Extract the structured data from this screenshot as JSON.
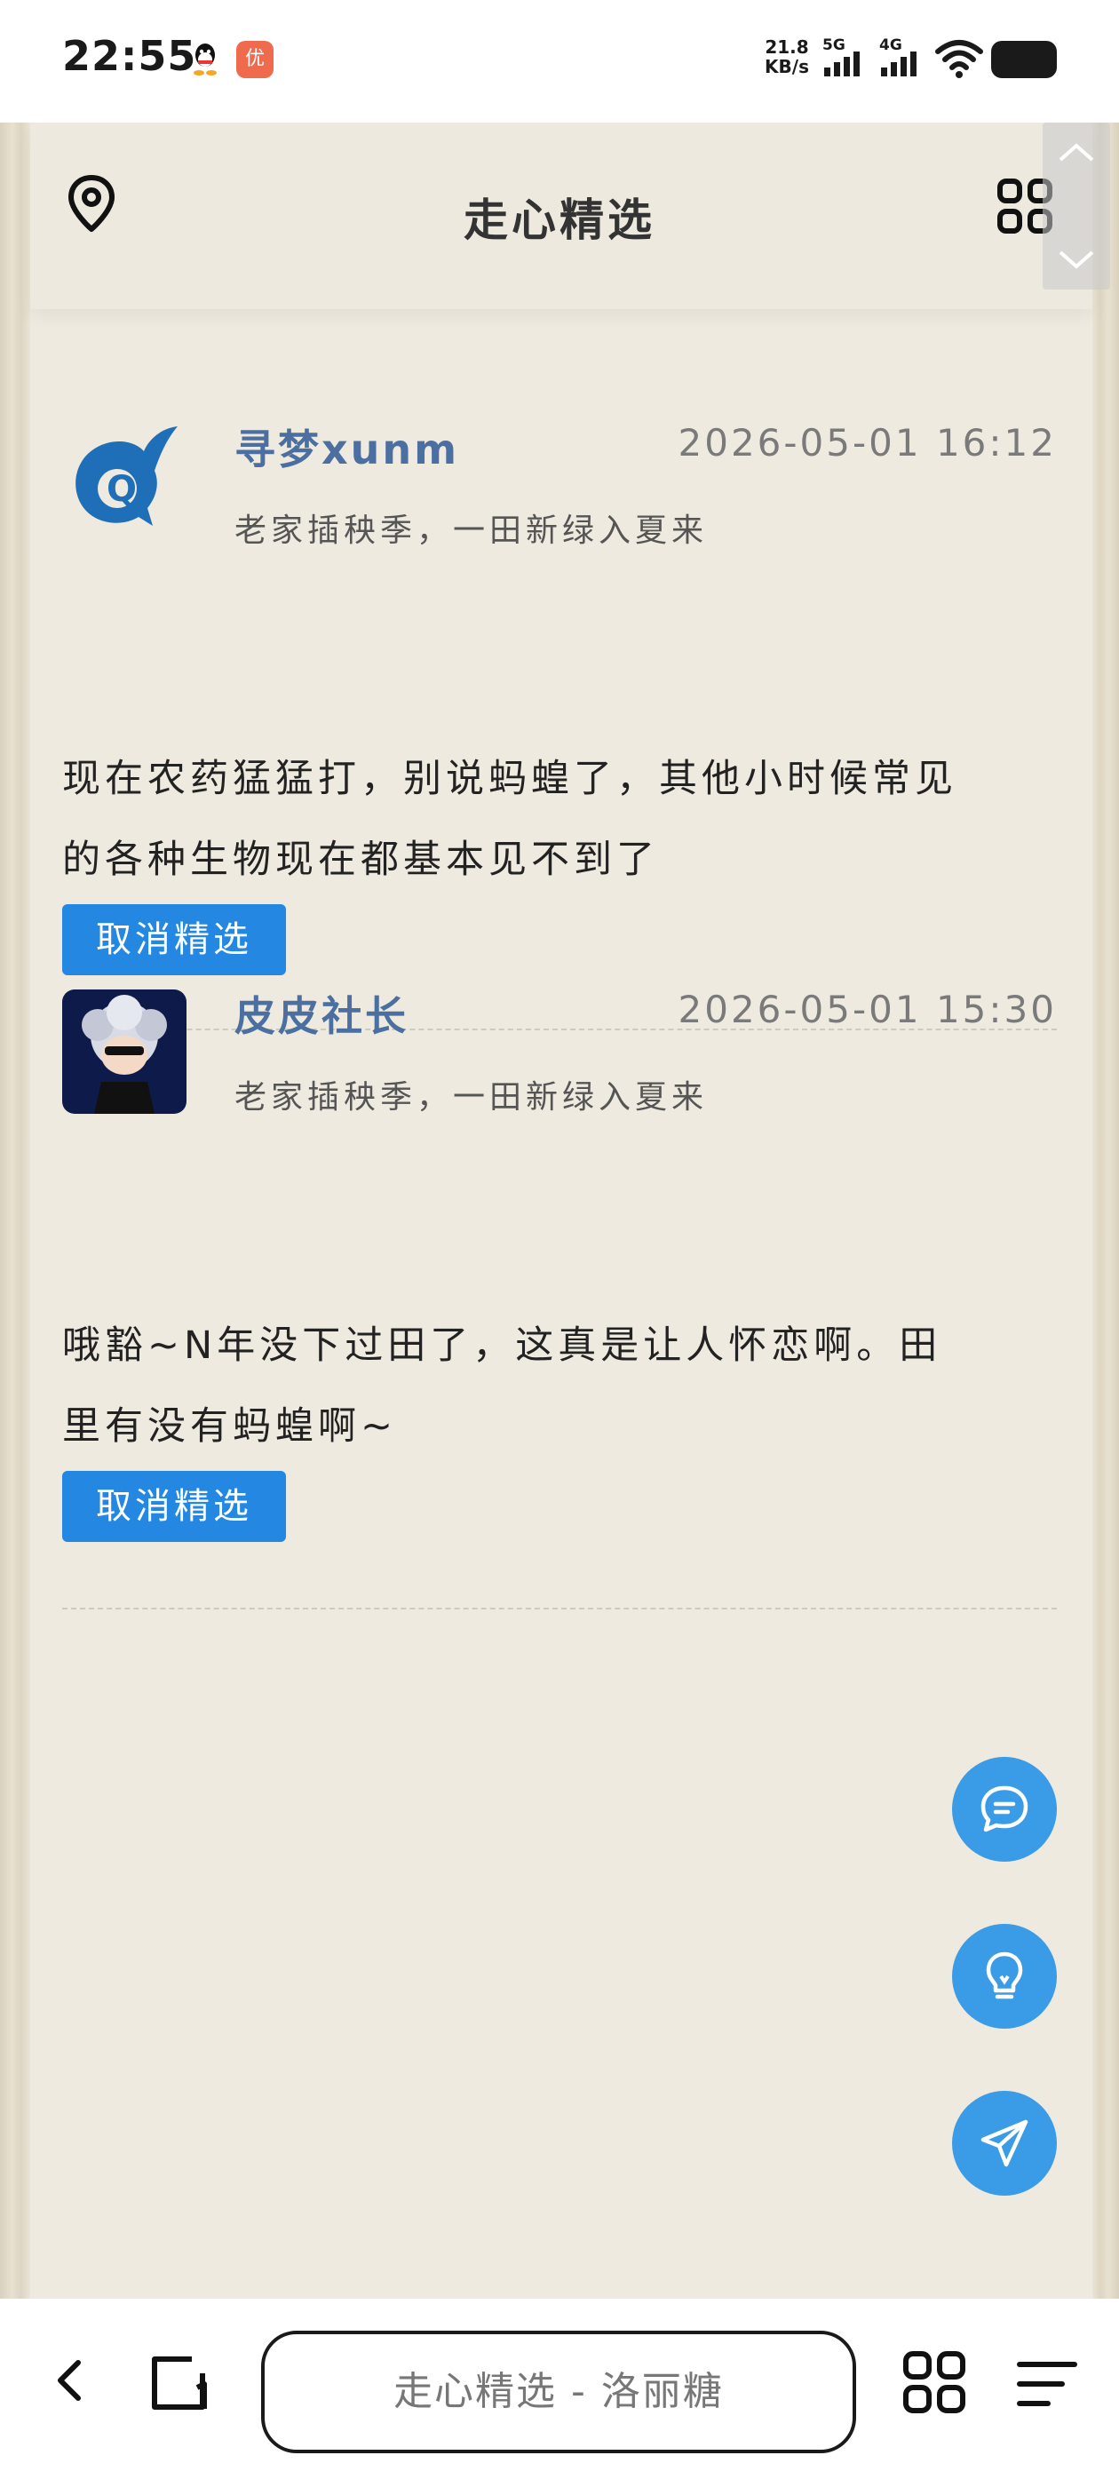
{
  "status_bar": {
    "time": "22:55",
    "net_speed_value": "21.8",
    "net_speed_unit": "KB/s",
    "signal_1_label": "5G",
    "signal_2_label": "4G",
    "app_badge": "优"
  },
  "header": {
    "title": "走心精选"
  },
  "posts": [
    {
      "user": "寻梦xunm",
      "time": "2026-05-01 16:12",
      "topic": "老家插秧季，一田新绿入夏来",
      "text_line1": "现在农药猛猛打，别说蚂蝗了，其他小时候常见",
      "text_line2": "的各种生物现在都基本见不到了",
      "button": "取消精选"
    },
    {
      "user": "皮皮社长",
      "time": "2026-05-01 15:30",
      "topic": "老家插秧季，一田新绿入夏来",
      "text_line1": "哦豁~N年没下过田了，这真是让人怀恋啊。田",
      "text_line2": "里有没有蚂蝗啊~",
      "button": "取消精选"
    }
  ],
  "bottom_bar": {
    "url_text": "走心精选 - 洛丽糖"
  },
  "colors": {
    "accent": "#2487e2",
    "fab": "#3a9be6",
    "username": "#4a6fa0",
    "page_bg": "#efeae0"
  },
  "icons": [
    "qq-icon",
    "location-pin-icon",
    "grid-icon",
    "chat-bubble-icon",
    "lightbulb-icon",
    "paper-plane-icon",
    "back-icon",
    "tabs-icon",
    "apps-icon",
    "menu-icon"
  ]
}
